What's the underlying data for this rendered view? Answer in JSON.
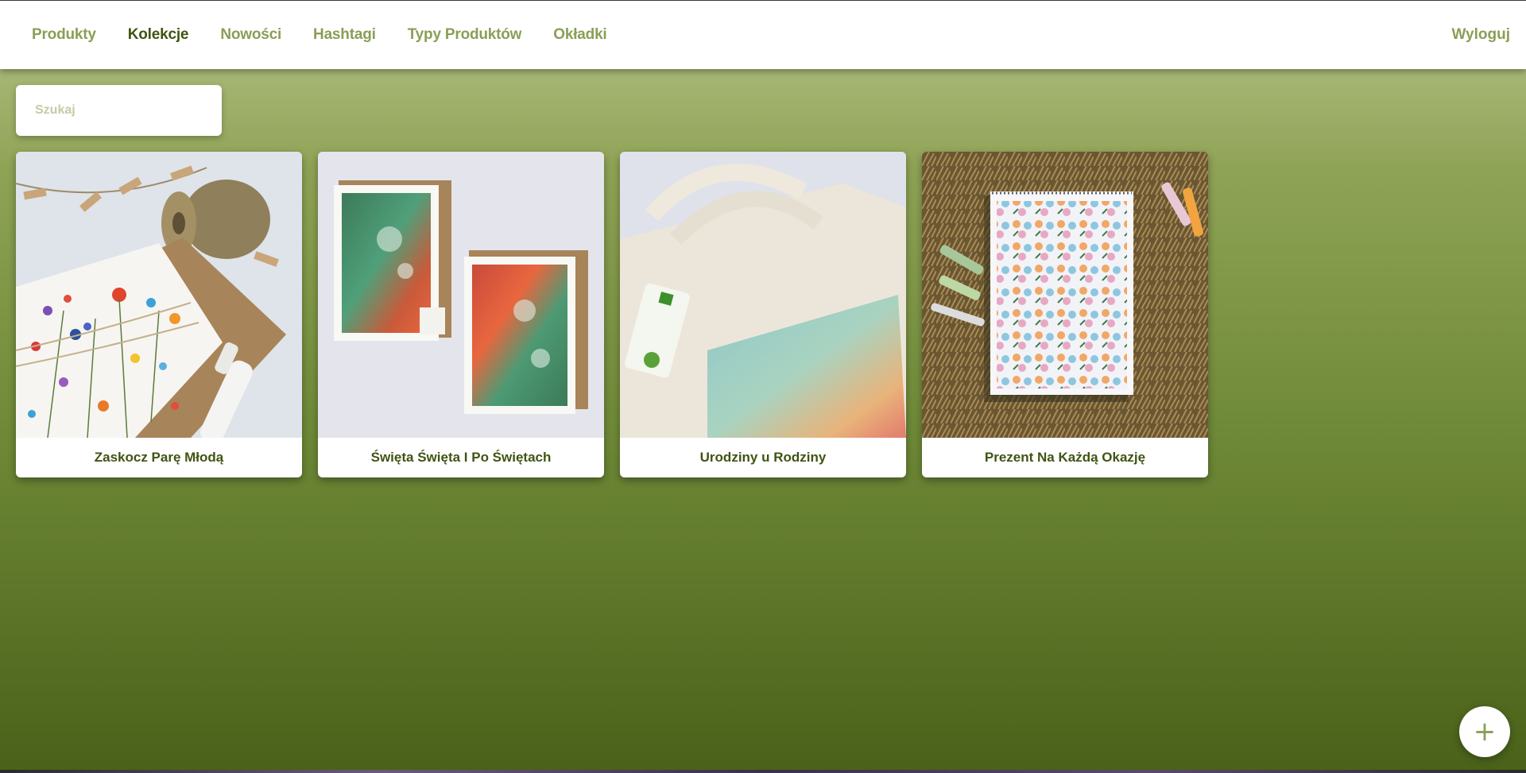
{
  "nav": {
    "items": [
      {
        "label": "Produkty",
        "active": false
      },
      {
        "label": "Kolekcje",
        "active": true
      },
      {
        "label": "Nowości",
        "active": false
      },
      {
        "label": "Hashtagi",
        "active": false
      },
      {
        "label": "Typy Produktów",
        "active": false
      },
      {
        "label": "Okładki",
        "active": false
      }
    ],
    "logout_label": "Wyloguj"
  },
  "search": {
    "placeholder": "Szukaj",
    "value": ""
  },
  "collections": [
    {
      "title": "Zaskocz Parę Młodą",
      "image": "wildflower-card-with-twine"
    },
    {
      "title": "Święta Święta I Po Świętach",
      "image": "abstract-green-greeting-cards"
    },
    {
      "title": "Urodziny u Rodziny",
      "image": "organic-cotton-tote-bag"
    },
    {
      "title": "Prezent Na Każdą Okazję",
      "image": "floral-notebook-on-grass"
    }
  ],
  "fab": {
    "icon": "plus-icon",
    "symbol": "+"
  },
  "colors": {
    "accent": "#8a9e56",
    "active": "#3f5413",
    "background_top": "#b6c48a",
    "background_bottom": "#4a6119"
  }
}
